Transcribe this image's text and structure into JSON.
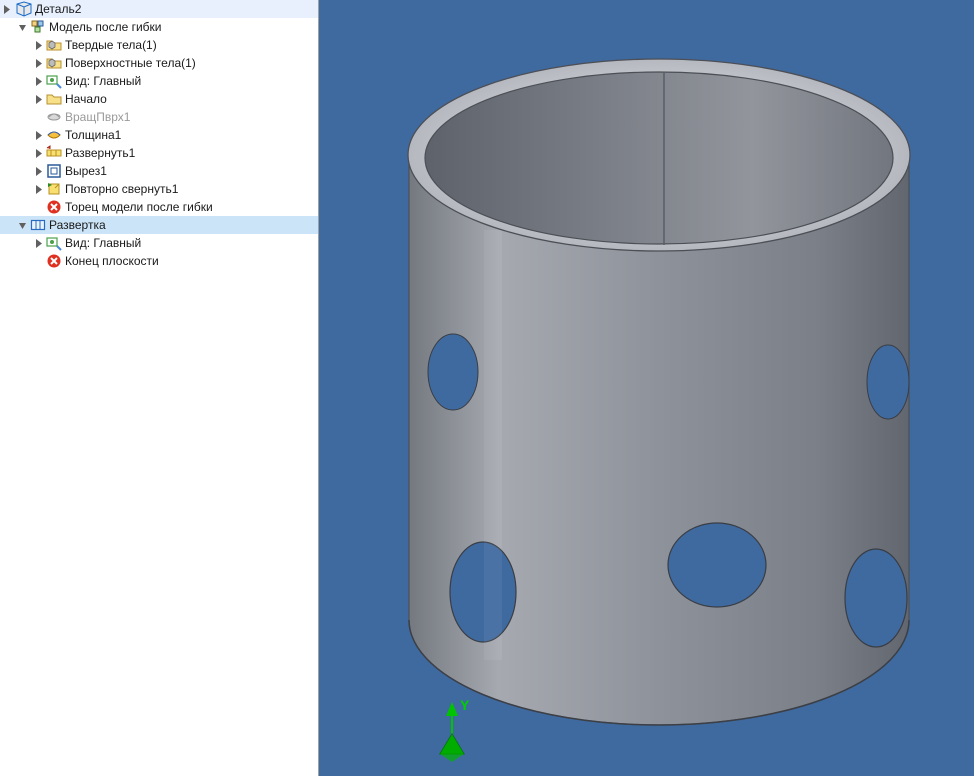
{
  "tree": {
    "root": {
      "label": "Деталь2",
      "icon": "part-icon"
    },
    "nodes": [
      {
        "label": "Модель после гибки",
        "icon": "assembly-icon",
        "indent": 1,
        "expander": "open",
        "interactable": true
      },
      {
        "label": "Твердые тела(1)",
        "icon": "solid-body-folder-icon",
        "indent": 2,
        "expander": "closed",
        "interactable": true
      },
      {
        "label": "Поверхностные тела(1)",
        "icon": "surface-body-folder-icon",
        "indent": 2,
        "expander": "closed",
        "interactable": true
      },
      {
        "label": "Вид: Главный",
        "icon": "view-icon",
        "indent": 2,
        "expander": "closed",
        "interactable": true
      },
      {
        "label": "Начало",
        "icon": "origin-folder-icon",
        "indent": 2,
        "expander": "closed",
        "interactable": true
      },
      {
        "label": "ВращПврх1",
        "icon": "revolve-surface-icon",
        "indent": 2,
        "expander": "blank",
        "interactable": true,
        "disabled": true
      },
      {
        "label": "Толщина1",
        "icon": "thicken-icon",
        "indent": 2,
        "expander": "closed",
        "interactable": true
      },
      {
        "label": "Развернуть1",
        "icon": "unfold-icon",
        "indent": 2,
        "expander": "closed",
        "interactable": true
      },
      {
        "label": "Вырез1",
        "icon": "cut-icon",
        "indent": 2,
        "expander": "closed",
        "interactable": true
      },
      {
        "label": "Повторно свернуть1",
        "icon": "refold-icon",
        "indent": 2,
        "expander": "closed",
        "interactable": true
      },
      {
        "label": "Торец модели после гибки",
        "icon": "error-icon",
        "indent": 2,
        "expander": "blank",
        "interactable": true
      },
      {
        "label": "Развертка",
        "icon": "flat-pattern-icon",
        "indent": 1,
        "expander": "open",
        "interactable": true,
        "selected": true
      },
      {
        "label": "Вид: Главный",
        "icon": "view-icon",
        "indent": 2,
        "expander": "closed",
        "interactable": true
      },
      {
        "label": "Конец плоскости",
        "icon": "error-icon",
        "indent": 2,
        "expander": "blank",
        "interactable": true
      }
    ]
  },
  "viewport": {
    "background": "#3f6aa0",
    "axis_label": "Y"
  },
  "colors": {
    "cylinder_light": "#9a9ea6",
    "cylinder_mid": "#8a8e97",
    "cylinder_dark": "#6e737d",
    "rim": "#c8cbd1",
    "edge": "#4a4d55",
    "hole": "#3f6aa0",
    "axis_line": "#00b400",
    "axis_fill": "#00a000"
  }
}
